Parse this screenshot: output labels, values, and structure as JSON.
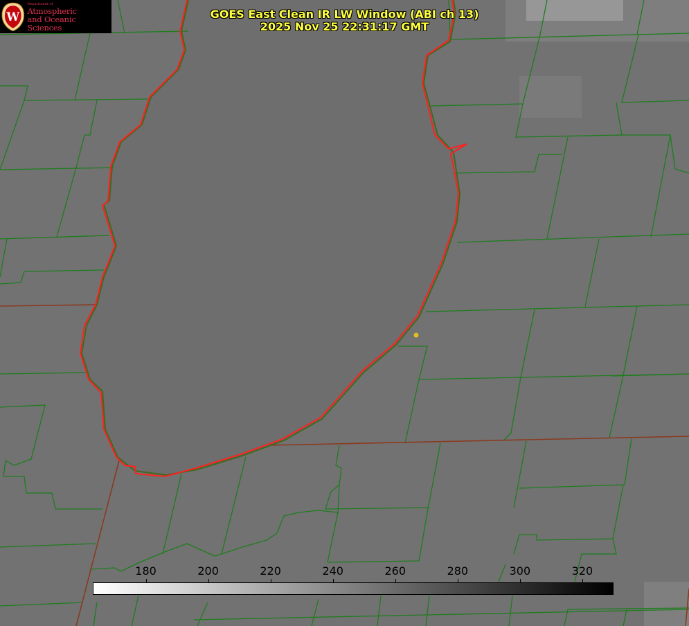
{
  "title": {
    "line1": "GOES East Clean IR LW Window (ABI ch 13)",
    "line2": "2025 Nov 25 22:31:17 GMT"
  },
  "logo": {
    "dept": "Department of",
    "line1": "Atmospheric",
    "line2": "and Oceanic Sciences",
    "crest_letter": "W"
  },
  "colorbar": {
    "units_min": 163,
    "units_max": 330,
    "ticks": [
      "180",
      "200",
      "220",
      "240",
      "260",
      "280",
      "300",
      "320"
    ],
    "tick_values": [
      180,
      200,
      220,
      240,
      260,
      280,
      300,
      320
    ],
    "color_low": "#ffffff",
    "color_high": "#000000"
  },
  "colors": {
    "county_lines": "#1e7d1e",
    "lake_outline": "#ff2020",
    "state_lines": "#8a3a20",
    "marker": "#e0c020",
    "title_text": "#ffff40"
  }
}
